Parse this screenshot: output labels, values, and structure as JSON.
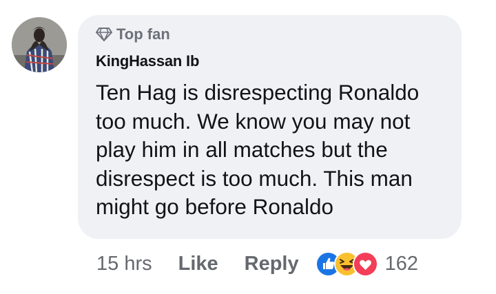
{
  "comment": {
    "badge": "Top fan",
    "author": "KingHassan Ib",
    "text": "Ten Hag is disrespecting Ronaldo too much. We know you may not play him in all matches but the disrespect is too much. This man might go before Ronaldo",
    "lines": [
      "Ten Hag is disrespecting Ronaldo",
      "too much. We know you may not",
      "play him in all matches but the",
      "disrespect is too much. This man",
      "might go before Ronaldo"
    ]
  },
  "actions": {
    "time": "15 hrs",
    "like_label": "Like",
    "reply_label": "Reply",
    "reactions": [
      "like-icon",
      "haha-icon",
      "love-icon"
    ],
    "reaction_count": "162"
  },
  "colors": {
    "bubble": "#eff1f4",
    "text": "#111317",
    "muted": "#65686e",
    "like_blue": "#1b74e4",
    "love_red": "#f33e58",
    "haha_yellow": "#fbc02d"
  }
}
